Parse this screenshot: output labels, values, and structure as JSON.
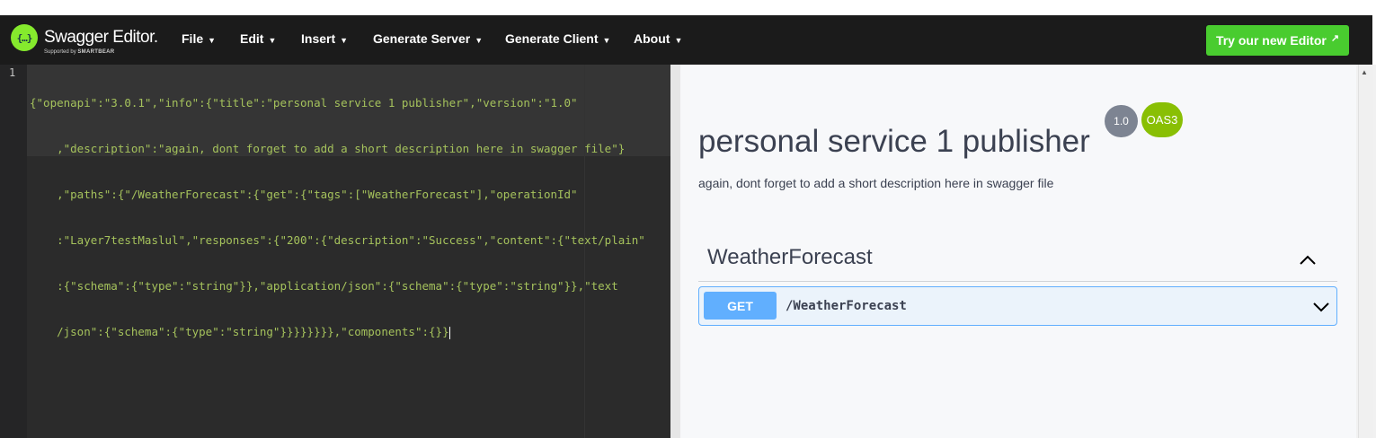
{
  "app": {
    "name": "Swagger Editor.",
    "logo_glyph": "{…}",
    "supported_by": "Supported by",
    "company": "SMARTBEAR"
  },
  "menu": [
    {
      "label": "File"
    },
    {
      "label": "Edit"
    },
    {
      "label": "Insert"
    },
    {
      "label": "Generate Server"
    },
    {
      "label": "Generate Client"
    },
    {
      "label": "About"
    }
  ],
  "try_button": {
    "label": "Try our new Editor",
    "icon": "external-arrow-icon"
  },
  "editor": {
    "line_number": "1",
    "lines": [
      "{\"openapi\":\"3.0.1\",\"info\":{\"title\":\"personal service 1 publisher\",\"version\":\"1.0\"",
      "    ,\"description\":\"again, dont forget to add a short description here in swagger file\"}",
      "    ,\"paths\":{\"/WeatherForecast\":{\"get\":{\"tags\":[\"WeatherForecast\"],\"operationId\"",
      "    :\"Layer7testMaslul\",\"responses\":{\"200\":{\"description\":\"Success\",\"content\":{\"text/plain\"",
      "    :{\"schema\":{\"type\":\"string\"}},\"application/json\":{\"schema\":{\"type\":\"string\"}},\"text",
      "    /json\":{\"schema\":{\"type\":\"string\"}}}}}}}},\"components\":{}}"
    ]
  },
  "preview": {
    "title": "personal service 1 publisher",
    "version_badge": "1.0",
    "oas_badge": "OAS3",
    "description": "again, dont forget to add a short description here in swagger file",
    "tag": "WeatherForecast",
    "operation": {
      "method": "GET",
      "path": "/WeatherForecast"
    }
  },
  "colors": {
    "navbar": "#1b1b1b",
    "brand_green": "#85ea2d",
    "try_button": "#49cc2f",
    "editor_bg": "#2b2b2b",
    "code_text": "#a5c25c",
    "get_blue": "#61affe",
    "oas_badge": "#89bf04",
    "version_badge": "#7d8492"
  }
}
